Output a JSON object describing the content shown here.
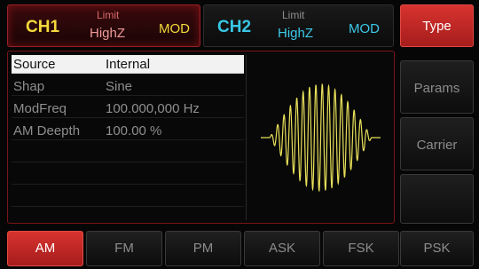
{
  "channels": {
    "ch1": {
      "name": "CH1",
      "limit": "Limit",
      "impedance": "HighZ",
      "mode": "MOD"
    },
    "ch2": {
      "name": "CH2",
      "limit": "Limit",
      "impedance": "HighZ",
      "mode": "MOD"
    }
  },
  "side_menu": {
    "items": [
      {
        "label": "Type",
        "active": true
      },
      {
        "label": "Params",
        "active": false
      },
      {
        "label": "Carrier",
        "active": false
      },
      {
        "label": "",
        "active": false
      }
    ]
  },
  "params": {
    "rows": [
      {
        "label": "Source",
        "value": "Internal"
      },
      {
        "label": "Shap",
        "value": "Sine"
      },
      {
        "label": "ModFreq",
        "value": "100.000,000 Hz"
      },
      {
        "label": "AM Deepth",
        "value": "100.00 %"
      }
    ]
  },
  "waveform": {
    "color": "#e8e05a",
    "type": "AM sine modulated carrier"
  },
  "bottom_menu": {
    "items": [
      {
        "label": "AM",
        "active": true
      },
      {
        "label": "FM",
        "active": false
      },
      {
        "label": "PM",
        "active": false
      },
      {
        "label": "ASK",
        "active": false
      },
      {
        "label": "FSK",
        "active": false
      },
      {
        "label": "PSK",
        "active": false
      }
    ]
  },
  "colors": {
    "active_red": "#c82a27",
    "ch1_yellow": "#f3d93b",
    "ch2_cyan": "#38c7e6"
  }
}
